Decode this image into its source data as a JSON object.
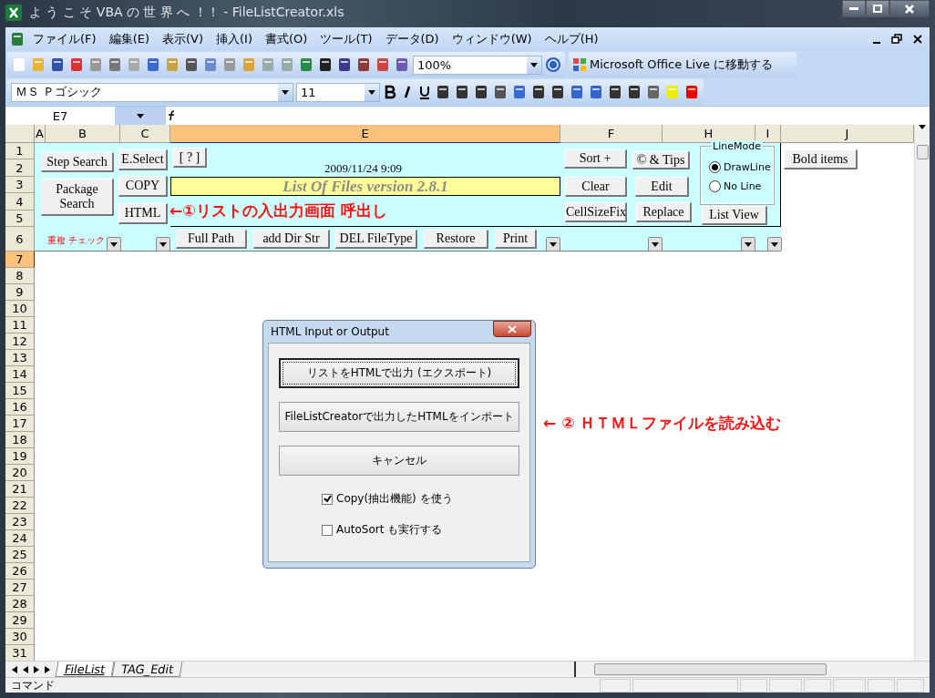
{
  "window": {
    "title": "よ う こ そ VBA の 世 界 へ ！！ - FileListCreator.xls"
  },
  "menu": [
    "ファイル(F)",
    "編集(E)",
    "表示(V)",
    "挿入(I)",
    "書式(O)",
    "ツール(T)",
    "データ(D)",
    "ウィンドウ(W)",
    "ヘルプ(H)"
  ],
  "standard_toolbar": {
    "zoom": "100%"
  },
  "office_live": {
    "label": "Microsoft Office Live に移動する"
  },
  "formatting_toolbar": {
    "font": "ＭＳ Ｐゴシック",
    "size": "11"
  },
  "formula_bar": {
    "name_box": "E7"
  },
  "columns": [
    {
      "label": "A",
      "selected": false
    },
    {
      "label": "B",
      "selected": false
    },
    {
      "label": "C",
      "selected": false
    },
    {
      "label": "E",
      "selected": true
    },
    {
      "label": "F",
      "selected": false
    },
    {
      "label": "H",
      "selected": false
    },
    {
      "label": "I",
      "selected": false
    },
    {
      "label": "J",
      "selected": false
    }
  ],
  "rows": [
    {
      "label": "1",
      "selected": false
    },
    {
      "label": "2",
      "selected": false
    },
    {
      "label": "3",
      "selected": false
    },
    {
      "label": "4",
      "selected": false
    },
    {
      "label": "5",
      "selected": false
    },
    {
      "label": "6",
      "selected": false
    },
    {
      "label": "7",
      "selected": true
    },
    {
      "label": "8",
      "selected": false
    },
    {
      "label": "9",
      "selected": false
    },
    {
      "label": "10",
      "selected": false
    },
    {
      "label": "11",
      "selected": false
    },
    {
      "label": "12",
      "selected": false
    },
    {
      "label": "13",
      "selected": false
    },
    {
      "label": "14",
      "selected": false
    },
    {
      "label": "15",
      "selected": false
    },
    {
      "label": "16",
      "selected": false
    },
    {
      "label": "17",
      "selected": false
    },
    {
      "label": "18",
      "selected": false
    },
    {
      "label": "19",
      "selected": false
    },
    {
      "label": "20",
      "selected": false
    },
    {
      "label": "21",
      "selected": false
    },
    {
      "label": "22",
      "selected": false
    },
    {
      "label": "23",
      "selected": false
    },
    {
      "label": "24",
      "selected": false
    },
    {
      "label": "25",
      "selected": false
    },
    {
      "label": "26",
      "selected": false
    },
    {
      "label": "27",
      "selected": false
    },
    {
      "label": "28",
      "selected": false
    },
    {
      "label": "29",
      "selected": false
    },
    {
      "label": "30",
      "selected": false
    },
    {
      "label": "31",
      "selected": false
    }
  ],
  "sheet": {
    "buttons": [
      "Step Search",
      "Package Search",
      "E.Select",
      "COPY",
      "HTML",
      "[ ? ]",
      "Sort +",
      "© & Tips",
      "Clear",
      "Edit",
      "CellSizeFix",
      "Replace",
      "List View",
      "Bold items",
      "Full Path",
      "add Dir Str",
      "DEL FileType",
      "Restore",
      "Print"
    ],
    "date": "2009/11/24 9:09",
    "banner": "List Of Files version 2.8.1",
    "note": "←①リストの入出力画面 呼出し",
    "check_label": "重複 チェック",
    "line_mode": {
      "title": "LineMode",
      "options": [
        {
          "label": "DrawLine",
          "selected": true
        },
        {
          "label": "No Line",
          "selected": false
        }
      ]
    }
  },
  "dialog": {
    "title": "HTML Input or Output",
    "buttons": [
      {
        "label": "リストをHTMLで出力 (エクスポート)",
        "focused": true
      },
      {
        "label": "FileListCreatorで出力したHTMLをインポート",
        "focused": false
      },
      {
        "label": "キャンセル",
        "focused": false
      }
    ],
    "checkboxes": [
      {
        "label": "Copy(抽出機能) を使う",
        "checked": true
      },
      {
        "label": "AutoSort も実行する",
        "checked": false
      }
    ]
  },
  "annotation": "← ② ＨＴＭＬファイルを読み込む",
  "sheet_tabs": [
    {
      "label": "FileList",
      "selected": true
    },
    {
      "label": "TAG_Edit",
      "selected": false
    }
  ],
  "status_bar": {
    "text": "コマンド"
  }
}
